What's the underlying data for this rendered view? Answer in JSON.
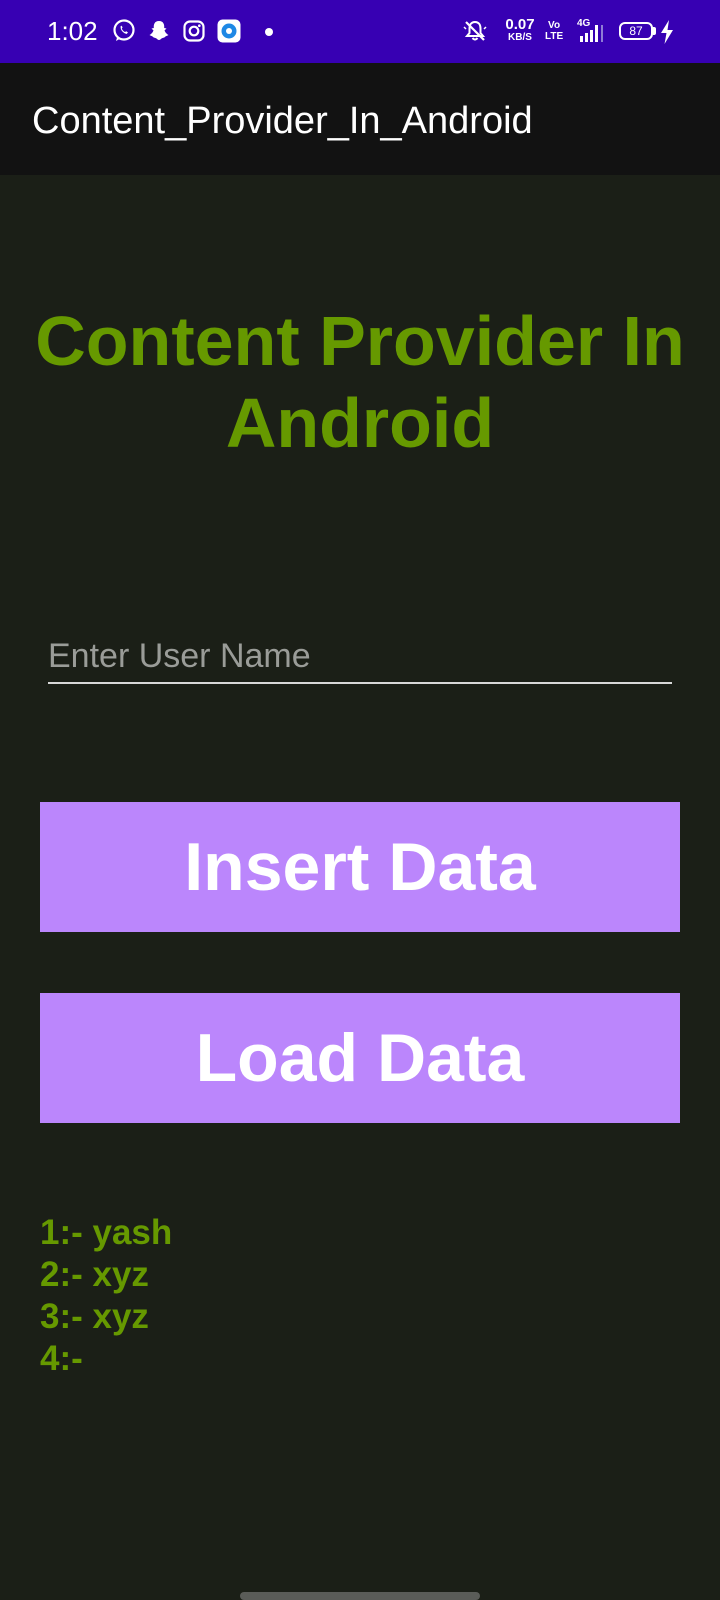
{
  "status_bar": {
    "time": "1:02",
    "net_speed_value": "0.07",
    "net_speed_unit": "KB/S",
    "volte_top": "Vo",
    "volte_bottom": "LTE",
    "network_type": "4G",
    "battery_level": "87",
    "icons": [
      "whatsapp-icon",
      "snapchat-icon",
      "instagram-icon",
      "app-icon",
      "notification-dot",
      "mute-bell-icon",
      "signal-icon",
      "charging-icon"
    ],
    "background_color": "#3700b3"
  },
  "app_bar": {
    "title": "Content_Provider_In_Android",
    "background_color": "#121212"
  },
  "main": {
    "heading": "Content Provider In Android",
    "username_input": {
      "placeholder": "Enter User Name",
      "value": ""
    },
    "insert_button_label": "Insert Data",
    "load_button_label": "Load Data",
    "results": [
      "1:- yash",
      "2:- xyz",
      "3:- xyz",
      "4:-"
    ]
  },
  "colors": {
    "accent_green": "#669900",
    "button_purple": "#bb86fc",
    "background": "#1b1f17"
  }
}
